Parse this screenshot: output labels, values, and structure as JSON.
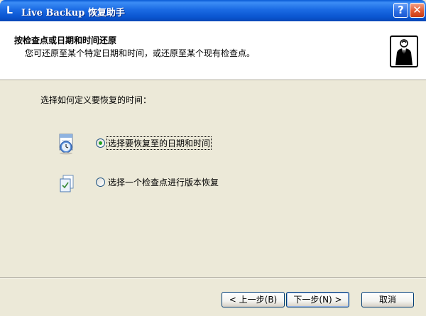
{
  "window": {
    "title": "Live Backup 恢复助手",
    "app_icon": "L"
  },
  "titlebar": {
    "help_label": "?",
    "close_label": "✕"
  },
  "header": {
    "title": "按检查点或日期和时间还原",
    "subtitle": "您可还原至某个特定日期和时间，或还原至某个现有检查点。",
    "icon": "wizard-person-icon"
  },
  "body": {
    "instruction": "选择如何定义要恢复的时间：",
    "options": [
      {
        "label": "选择要恢复至的日期和时间",
        "checked": true,
        "icon": "calendar-clock-icon"
      },
      {
        "label": "选择一个检查点进行版本恢复",
        "checked": false,
        "icon": "checkpoint-document-icon"
      }
    ]
  },
  "buttons": {
    "back": "< 上一步(B)",
    "next": "下一步(N) >",
    "cancel": "取消"
  },
  "colors": {
    "titlebar": "#0A55D0",
    "window_bg": "#ECE9D8",
    "header_bg": "#FFFFFF",
    "close_button": "#E35A30"
  }
}
